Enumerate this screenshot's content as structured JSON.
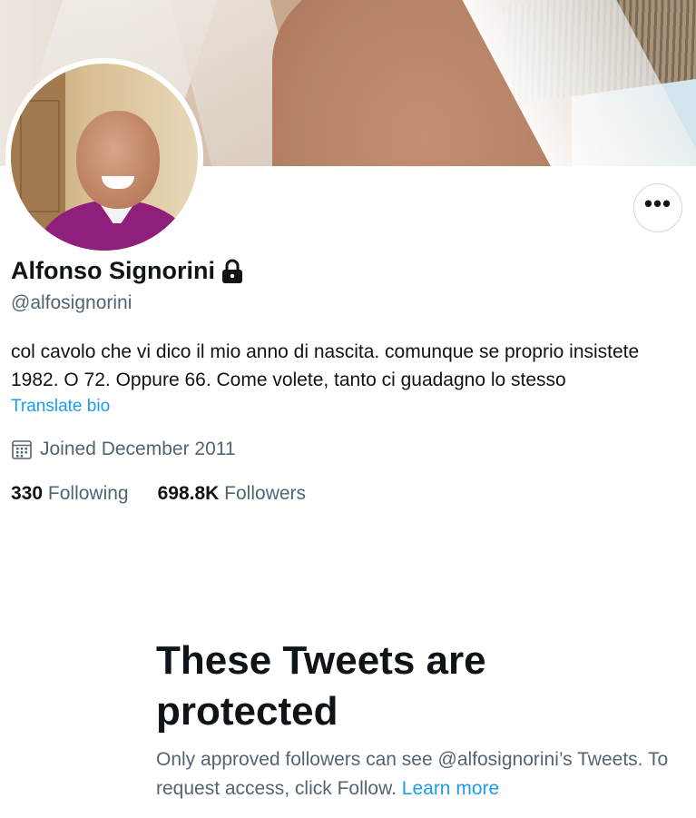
{
  "banner": {
    "description_icon": "profile-banner-photo"
  },
  "avatar": {
    "icon": "profile-avatar-photo"
  },
  "more_button": {
    "label": "•••",
    "icon": "more-horizontal-icon"
  },
  "profile": {
    "display_name": "Alfonso Signorini",
    "locked_icon": "lock-icon",
    "handle": "@alfosignorini",
    "bio_line1": "col cavolo che vi dico il mio anno di nascita. comunque se proprio insistete",
    "bio_line2": "1982. O 72. Oppure 66. Come volete, tanto ci guadagno lo stesso",
    "translate_bio": "Translate bio",
    "joined": "Joined December 2011",
    "following_count": "330",
    "following_label": "Following",
    "followers_count": "698.8K",
    "followers_label": "Followers"
  },
  "protected_notice": {
    "title": "These Tweets are protected",
    "text": "Only approved followers can see @alfosignorini’s Tweets. To request access, click Follow.",
    "learn_more": "Learn more"
  },
  "colors": {
    "link": "#1d9bf0",
    "text_primary": "#0f1419",
    "text_secondary": "#536471",
    "border": "#cfd9de"
  }
}
